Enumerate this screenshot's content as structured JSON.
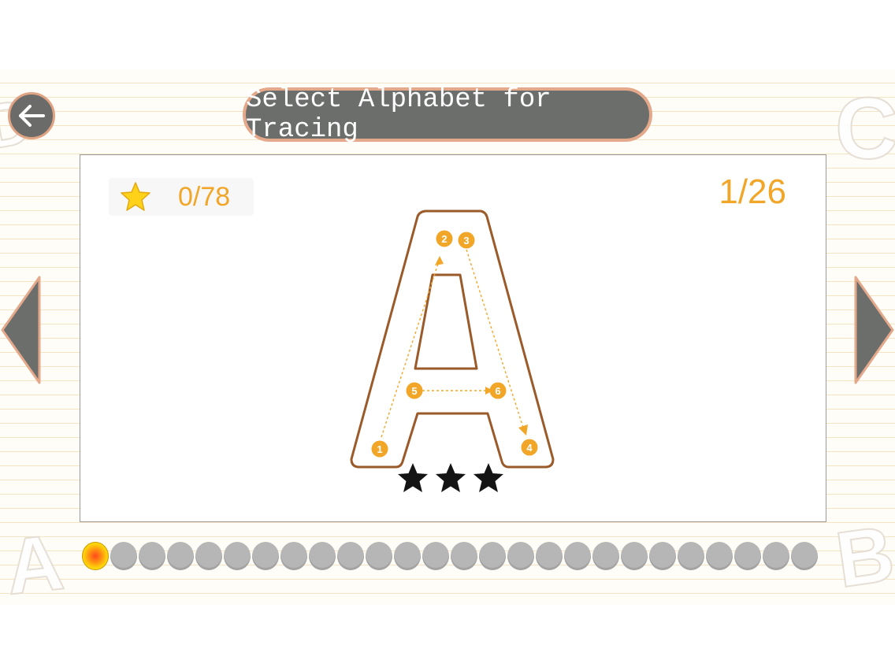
{
  "header": {
    "title": "Select Alphabet for Tracing"
  },
  "icons": {
    "back": "arrow-left-icon",
    "prev": "triangle-left-icon",
    "next": "triangle-right-icon",
    "score": "star-icon"
  },
  "card": {
    "score": "0/78",
    "page_counter": "1/26",
    "letter": "A",
    "stroke_numbers": [
      "1",
      "2",
      "3",
      "4",
      "5",
      "6"
    ],
    "rating": {
      "earned": 0,
      "total": 3
    }
  },
  "progress": {
    "total": 26,
    "current": 1
  },
  "decorative_letters": [
    "C",
    "A",
    "B",
    "D"
  ],
  "colors": {
    "accent_orange": "#f2a628",
    "letter_outline": "#9b5a2a",
    "button_gray": "#6c6e6c",
    "button_border": "#e4a88a",
    "dot_inactive": "#b6b6b6"
  }
}
